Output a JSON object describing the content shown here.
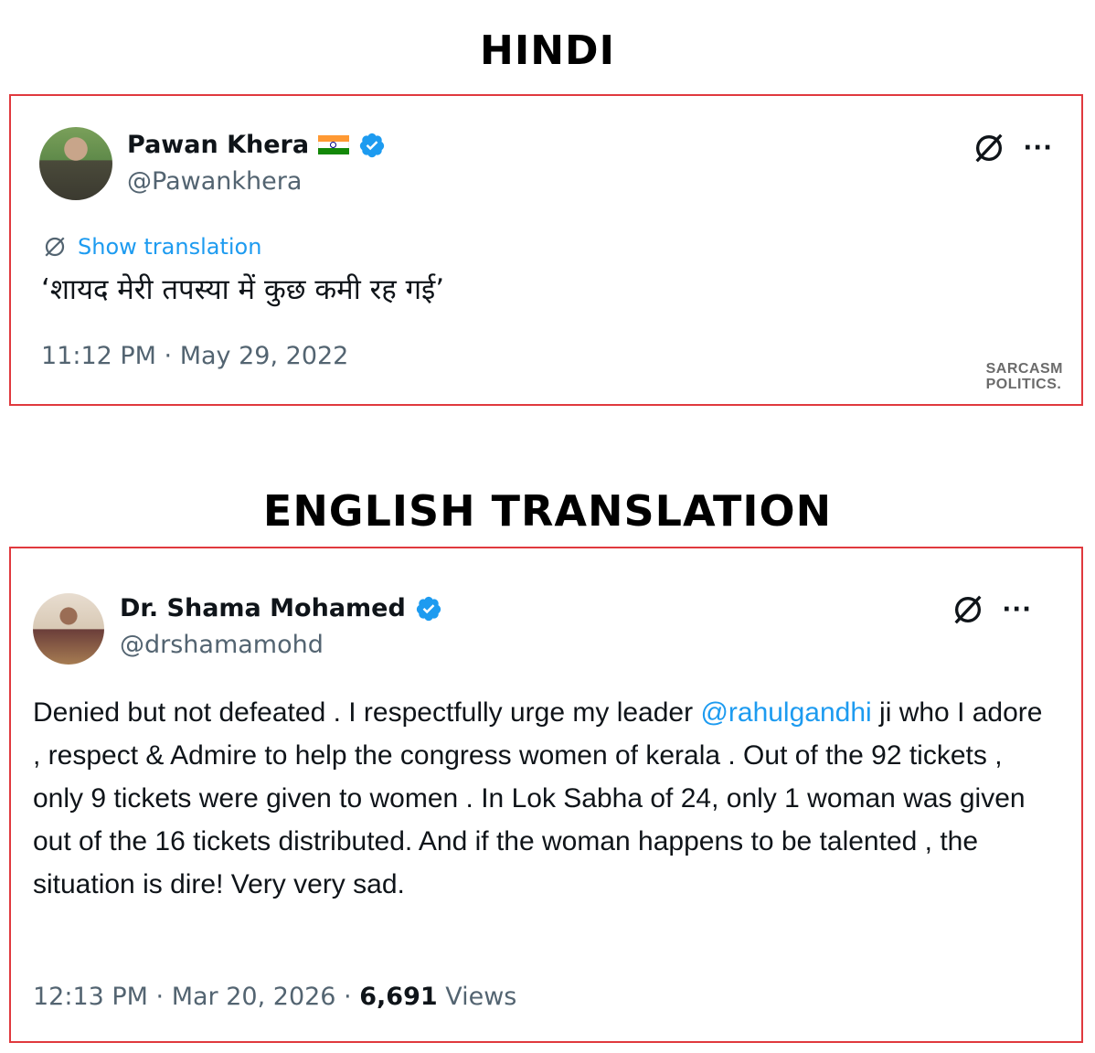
{
  "sections": {
    "hindi_title": "HINDI",
    "english_title": "ENGLISH TRANSLATION"
  },
  "tweet1": {
    "name": "Pawan Khera",
    "handle": "@Pawankhera",
    "show_translation": "Show translation",
    "text": "‘शायद मेरी तपस्या में कुछ कमी रह गई’",
    "timestamp": "11:12 PM · May 29, 2022",
    "watermark_line1": "SARCASM",
    "watermark_line2": "POLITICS."
  },
  "tweet2": {
    "name": "Dr. Shama Mohamed",
    "handle": "@drshamamohd",
    "text_before_mention": "Denied but not defeated . I respectfully urge my leader ",
    "mention": "@rahulgandhi",
    "text_after_mention": " ji who I adore , respect & Admire to help the congress women of kerala . Out of the 92 tickets , only 9 tickets were given to women . In Lok Sabha of 24, only 1 woman was given out of the 16 tickets distributed. And if the woman happens to be talented , the situation is dire! Very very sad.",
    "timestamp": "12:13 PM · Mar 20, 2026 · ",
    "views_count": "6,691",
    "views_label": " Views"
  },
  "colors": {
    "card_border": "#e0393e",
    "link_blue": "#1d9bf0",
    "muted_text": "#536471",
    "verified_blue": "#1d9bf0"
  },
  "icons": [
    "indian-flag-icon",
    "verified-badge-icon",
    "grok-icon",
    "more-icon",
    "translate-icon"
  ]
}
